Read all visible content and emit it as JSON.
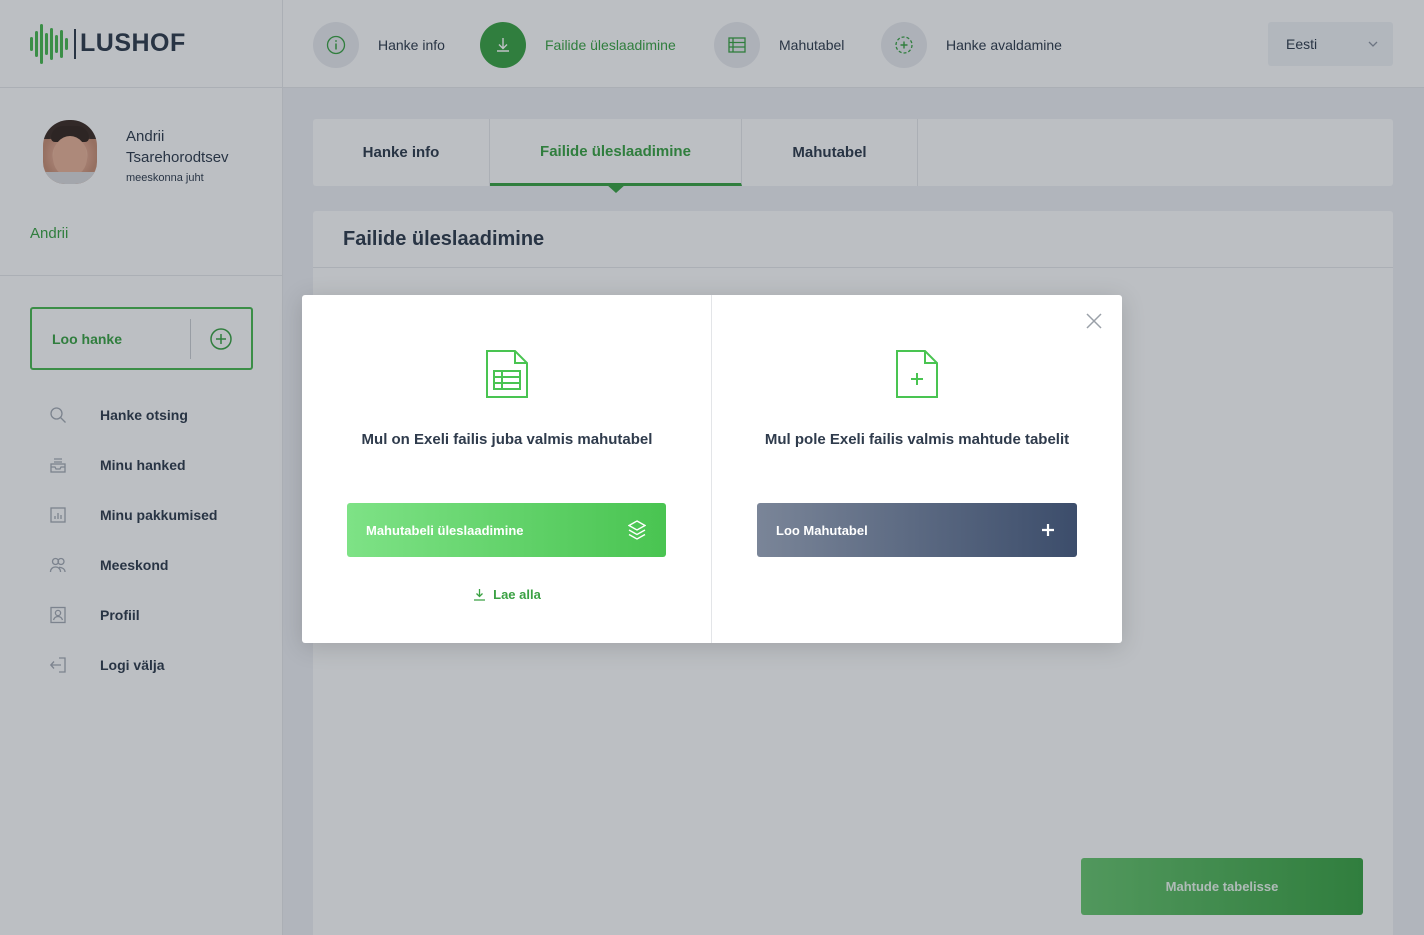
{
  "brand": {
    "name": "LUSHOF",
    "accent": "#3aa143"
  },
  "user": {
    "name": "Andrii Tsarehorodtsev",
    "role": "meeskonna juht",
    "link": "Andrii"
  },
  "sidebar": {
    "create_label": "Loo hanke",
    "items": [
      {
        "label": "Hanke otsing",
        "icon": "search-icon"
      },
      {
        "label": "Minu hanked",
        "icon": "inbox-icon"
      },
      {
        "label": "Minu pakkumised",
        "icon": "chart-icon"
      },
      {
        "label": "Meeskond",
        "icon": "team-icon"
      },
      {
        "label": "Profiil",
        "icon": "profile-icon"
      },
      {
        "label": "Logi välja",
        "icon": "logout-icon"
      }
    ]
  },
  "steps": [
    {
      "label": "Hanke info",
      "icon": "info-icon"
    },
    {
      "label": "Failide üleslaadimine",
      "icon": "download-icon",
      "active": true
    },
    {
      "label": "Mahutabel",
      "icon": "table-icon"
    },
    {
      "label": "Hanke avaldamine",
      "icon": "publish-icon"
    }
  ],
  "language": "Eesti",
  "tabs": [
    {
      "label": "Hanke info"
    },
    {
      "label": "Failide üleslaadimine",
      "active": true
    },
    {
      "label": "Mahutabel"
    }
  ],
  "panel": {
    "title": "Failide üleslaadimine",
    "submit_label": "Mahtude tabelisse"
  },
  "modal": {
    "left": {
      "text": "Mul on Exeli failis juba valmis mahutabel",
      "button": "Mahutabeli üleslaadimine",
      "link": "Lae alla"
    },
    "right": {
      "text": "Mul pole Exeli failis valmis mahtude tabelit",
      "button": "Loo Mahutabel"
    }
  }
}
